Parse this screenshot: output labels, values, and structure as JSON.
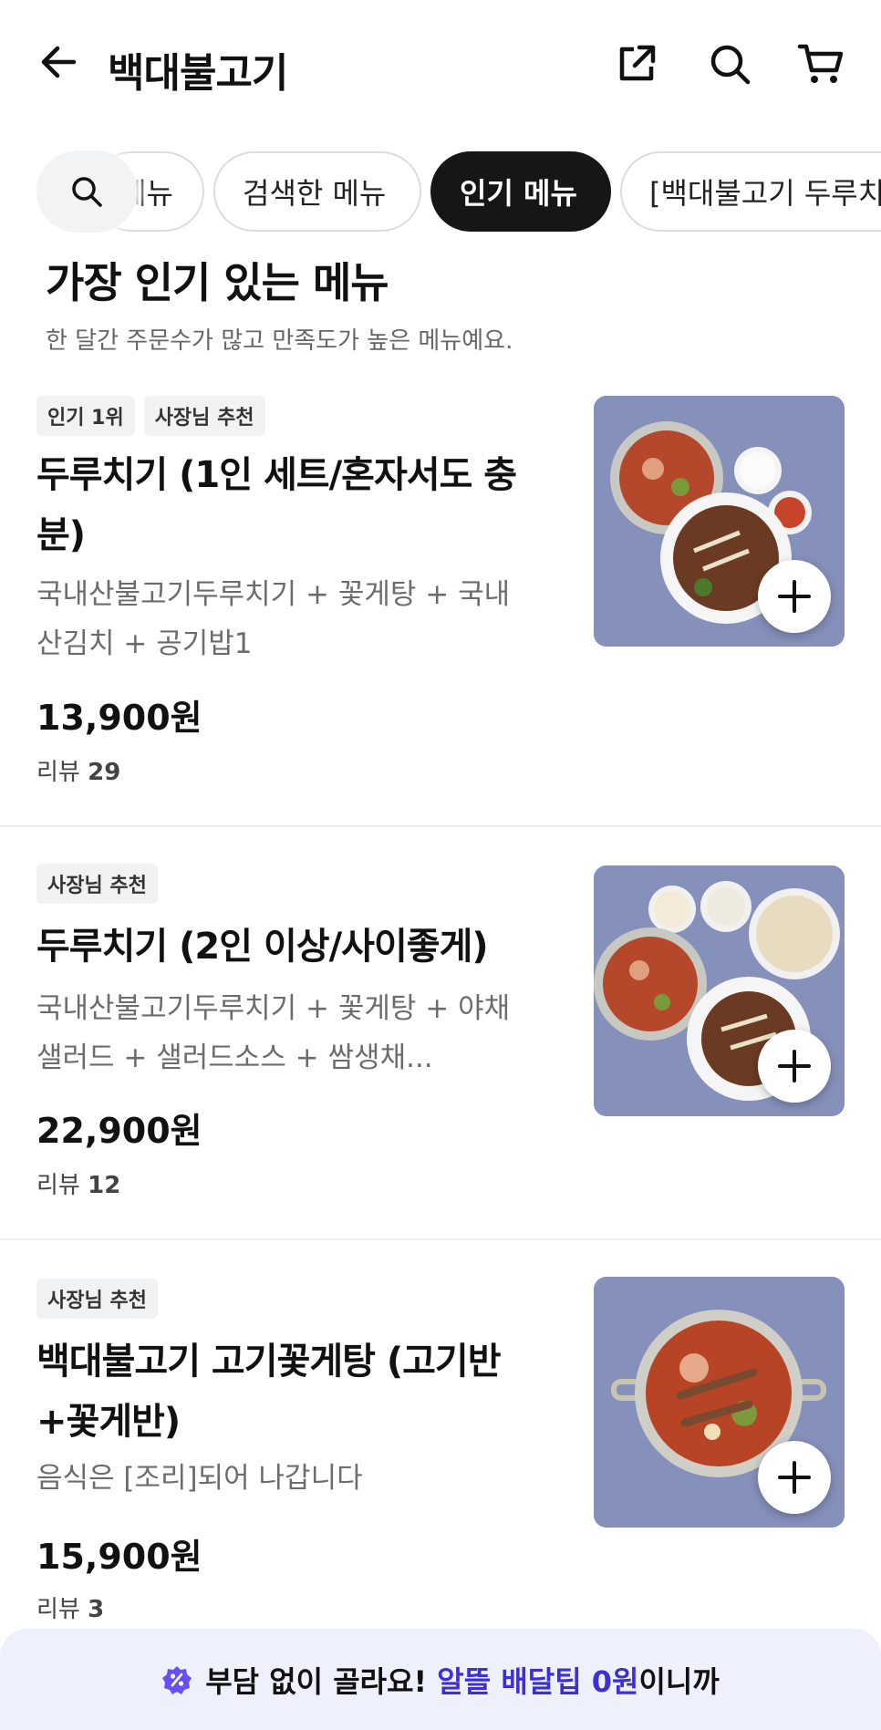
{
  "header": {
    "title": "백대불고기",
    "icons": [
      "back-arrow-icon",
      "share-icon",
      "search-icon",
      "cart-icon"
    ]
  },
  "chips": {
    "hidden_label": "메뉴",
    "searched": "검색한 메뉴",
    "popular": "인기 메뉴",
    "store_partial": "[백대불고기 두루치"
  },
  "section": {
    "title": "가장 인기 있는 메뉴",
    "subtitle": "한 달간 주문수가 많고 만족도가 높은 메뉴예요."
  },
  "items": [
    {
      "badges": [
        "인기 1위",
        "사장님 추천"
      ],
      "name": "두루치기 (1인 세트/혼자서도 충분)",
      "desc": "국내산불고기두루치기 + 꽃게탕 + 국내산김치 + 공기밥1",
      "price": "13,900원",
      "review_label": "리뷰",
      "review_count": "29"
    },
    {
      "badges": [
        "사장님 추천"
      ],
      "name": "두루치기 (2인 이상/사이좋게)",
      "desc": "국내산불고기두루치기 + 꽃게탕 + 야채샐러드 + 샐러드소스 + 쌈생채...",
      "price": "22,900원",
      "review_label": "리뷰",
      "review_count": "12"
    },
    {
      "badges": [
        "사장님 추천"
      ],
      "name": "백대불고기 고기꽃게탕 (고기반+꽃게반)",
      "desc": "음식은 [조리]되어 나갑니다",
      "price": "15,900원",
      "review_label": "리뷰",
      "review_count": "3"
    }
  ],
  "banner": {
    "prefix": "부담 없이 골라요! ",
    "highlight": "알뜰 배달팁 0원",
    "suffix": "이니까",
    "accent_color": "#3d2fd6"
  }
}
